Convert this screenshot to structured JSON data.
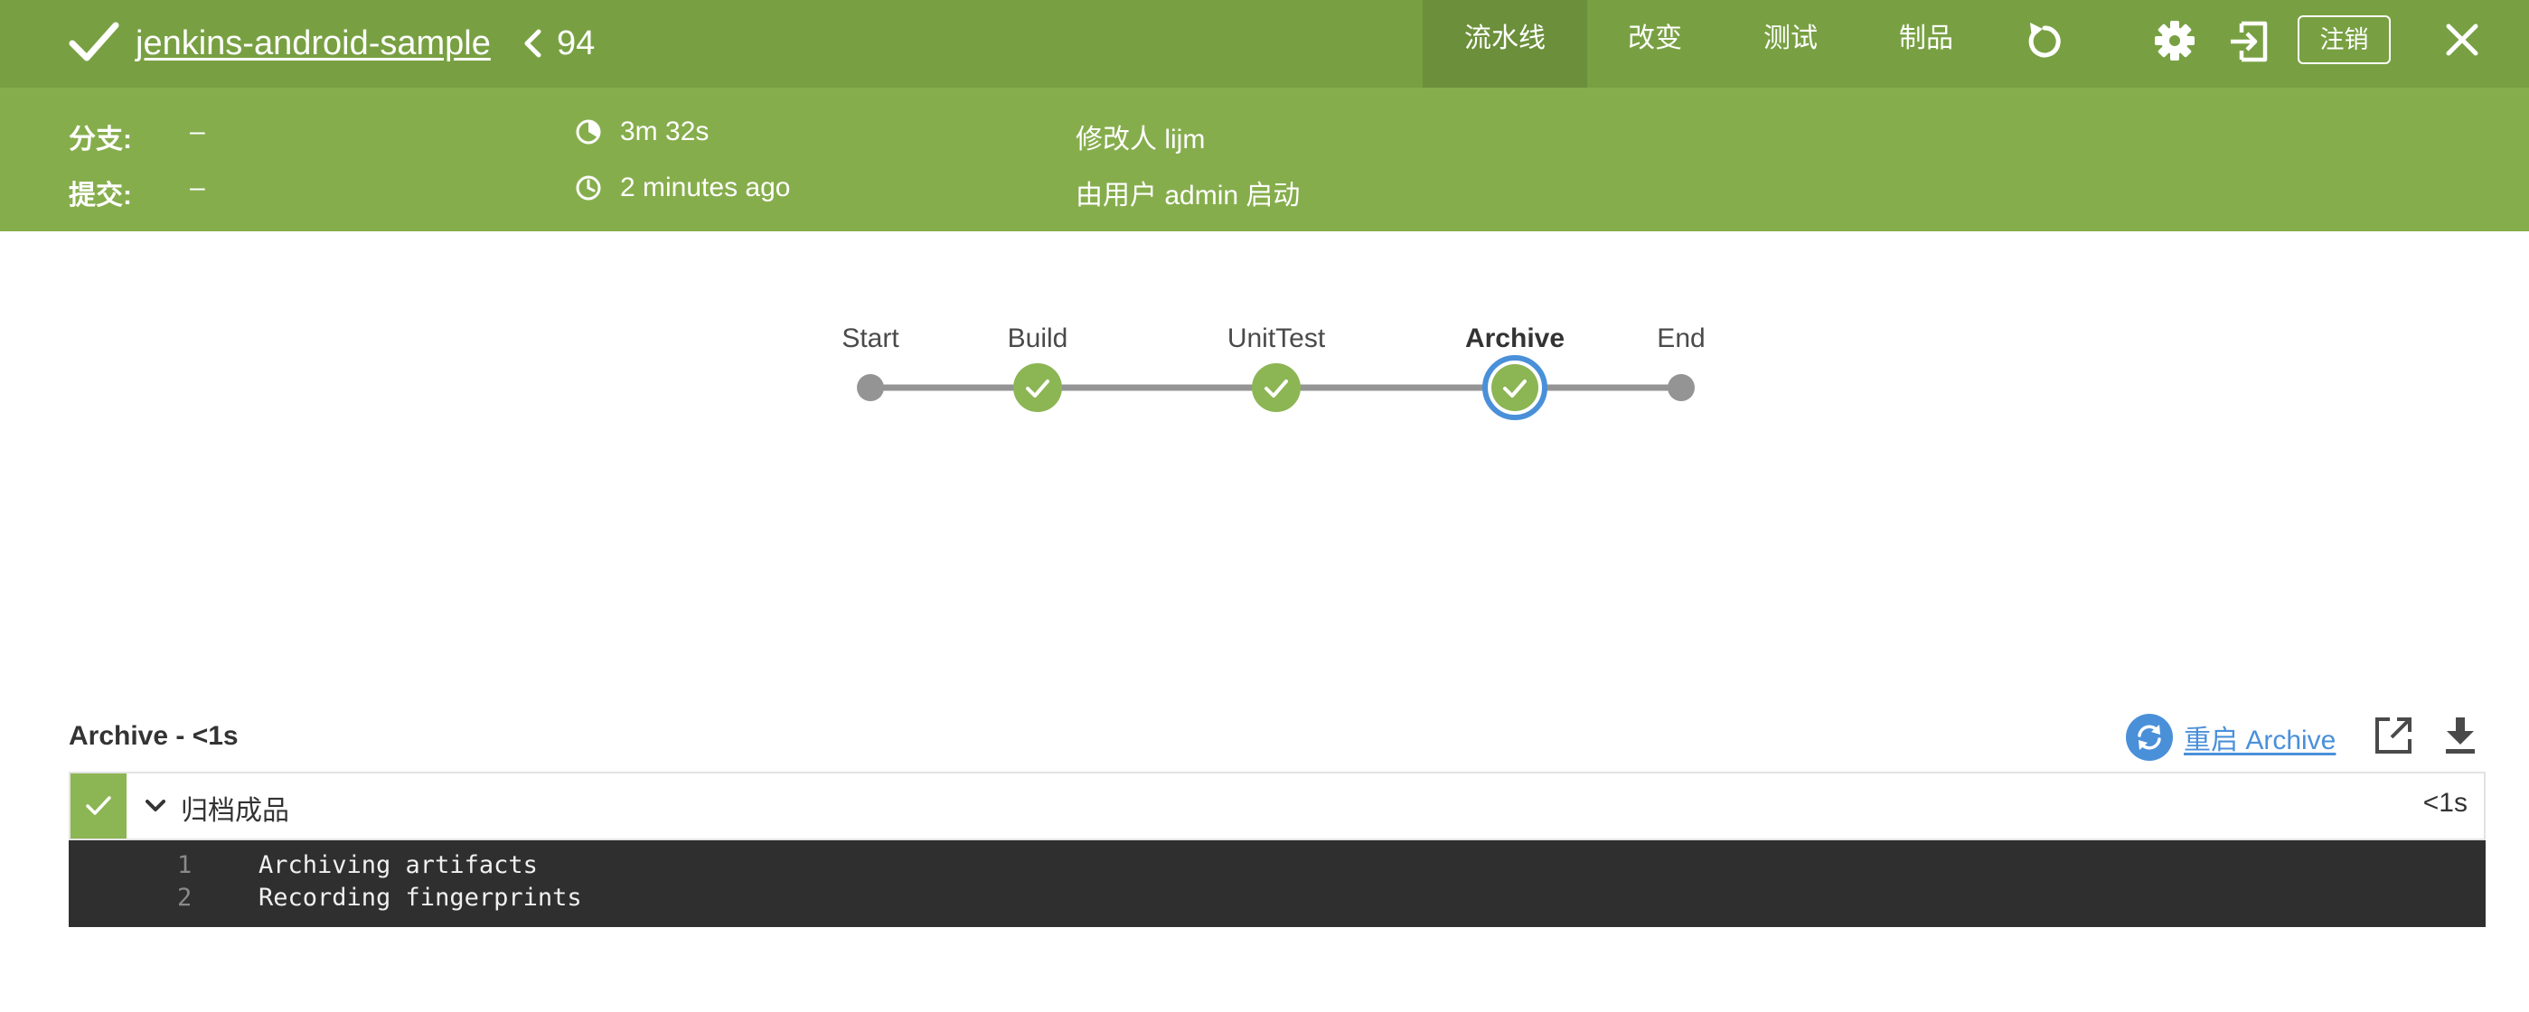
{
  "header": {
    "pipeline_name": "jenkins-android-sample",
    "run_number": "94",
    "tabs": [
      {
        "label": "流水线",
        "active": true
      },
      {
        "label": "改变",
        "active": false
      },
      {
        "label": "测试",
        "active": false
      },
      {
        "label": "制品",
        "active": false
      }
    ],
    "logout_label": "注销",
    "icons": [
      "check-icon",
      "chevron-left-icon",
      "rerun-icon",
      "gear-icon",
      "exit-icon",
      "close-icon"
    ]
  },
  "info": {
    "branch_label": "分支:",
    "branch_value": "–",
    "commit_label": "提交:",
    "commit_value": "–",
    "duration": "3m 32s",
    "started": "2 minutes ago",
    "changes": "修改人 lijm",
    "cause": "由用户 admin 启动"
  },
  "pipeline": {
    "stages": [
      {
        "name": "Start",
        "status": "node"
      },
      {
        "name": "Build",
        "status": "success"
      },
      {
        "name": "UnitTest",
        "status": "success"
      },
      {
        "name": "Archive",
        "status": "success",
        "selected": true
      },
      {
        "name": "End",
        "status": "node"
      }
    ]
  },
  "step_panel": {
    "title": "Archive - <1s",
    "restart_label": "重启 Archive",
    "steps": [
      {
        "name": "归档成品",
        "duration": "<1s",
        "status": "success"
      }
    ],
    "log": [
      {
        "num": "1",
        "text": "Archiving artifacts"
      },
      {
        "num": "2",
        "text": "Recording fingerprints"
      }
    ]
  },
  "colors": {
    "topbar": "#78a042",
    "infobar": "#86ad4c",
    "success": "#8cb554",
    "selected_ring": "#4a90d9",
    "link": "#4a90d9",
    "log_bg": "#2f2f2f"
  }
}
